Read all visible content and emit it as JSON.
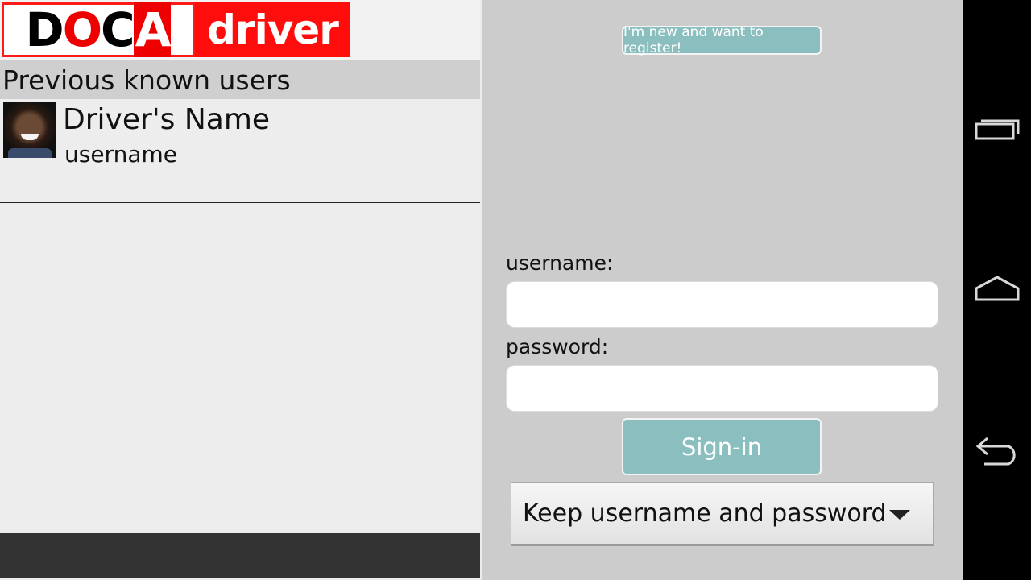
{
  "logo": {
    "part1": "DOCA",
    "part2": "driver"
  },
  "previous_users": {
    "title": "Previous known users",
    "items": [
      {
        "name": "Driver's Name",
        "username": "username"
      }
    ]
  },
  "login": {
    "register_label": "I'm new and want to register!",
    "username_label": "username:",
    "username_value": "",
    "password_label": "password:",
    "password_value": "",
    "signin_label": "Sign-in",
    "keep_option": "Keep username and password"
  },
  "navbar": {
    "icons": [
      "recent-apps-icon",
      "home-icon",
      "back-icon"
    ]
  },
  "colors": {
    "accent": "#8bbfbf",
    "logo_red": "#ff0d0d",
    "panel_right": "#cccccc",
    "panel_left": "#ededed"
  }
}
